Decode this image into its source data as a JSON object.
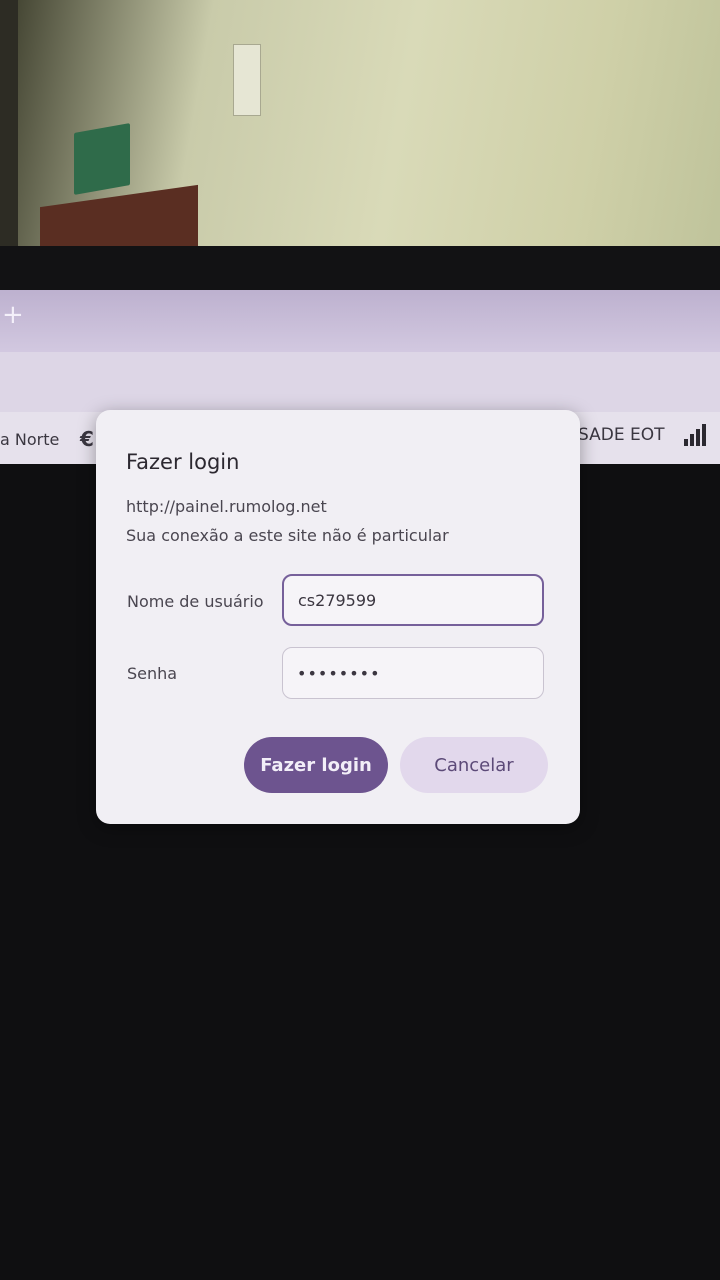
{
  "browser": {
    "new_tab_glyph": "+",
    "bookmarks": {
      "left_label": "a Norte",
      "edge_icon_glyph": "€",
      "right_label": "SADE EOT"
    }
  },
  "dialog": {
    "title": "Fazer login",
    "site_url": "http://painel.rumolog.net",
    "privacy_note": "Sua conexão a este site não é particular",
    "username": {
      "label": "Nome de usuário",
      "value": "cs279599"
    },
    "password": {
      "label": "Senha",
      "value": "••••••••"
    },
    "login_button": "Fazer login",
    "cancel_button": "Cancelar"
  },
  "colors": {
    "accent": "#6d548f",
    "cancel_bg": "#e2d8ec",
    "dialog_bg": "#f1eff4"
  }
}
